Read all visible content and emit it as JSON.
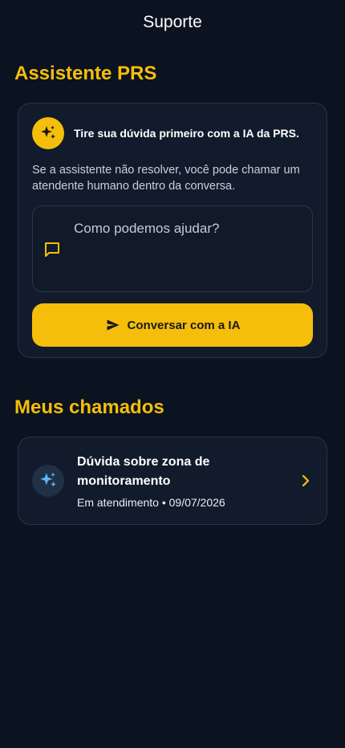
{
  "header": {
    "title": "Suporte"
  },
  "assistant": {
    "section_title": "Assistente PRS",
    "headline": "Tire sua dúvida primeiro com a IA da PRS.",
    "description": "Se a assistente não resolver, você pode chamar um atendente humano dentro da conversa.",
    "input": {
      "placeholder": "Como podemos ajudar?",
      "value": ""
    },
    "cta_label": "Conversar com a IA",
    "icon": "sparkles-icon"
  },
  "tickets": {
    "section_title": "Meus chamados",
    "items": [
      {
        "title": "Dúvida sobre zona de monitoramento",
        "meta": "Em atendimento • 09/07/2026",
        "icon": "sparkles-icon"
      }
    ]
  },
  "colors": {
    "background": "#0b1220",
    "card": "#121b2b",
    "accent": "#f5be0b",
    "border": "#2b3546"
  }
}
